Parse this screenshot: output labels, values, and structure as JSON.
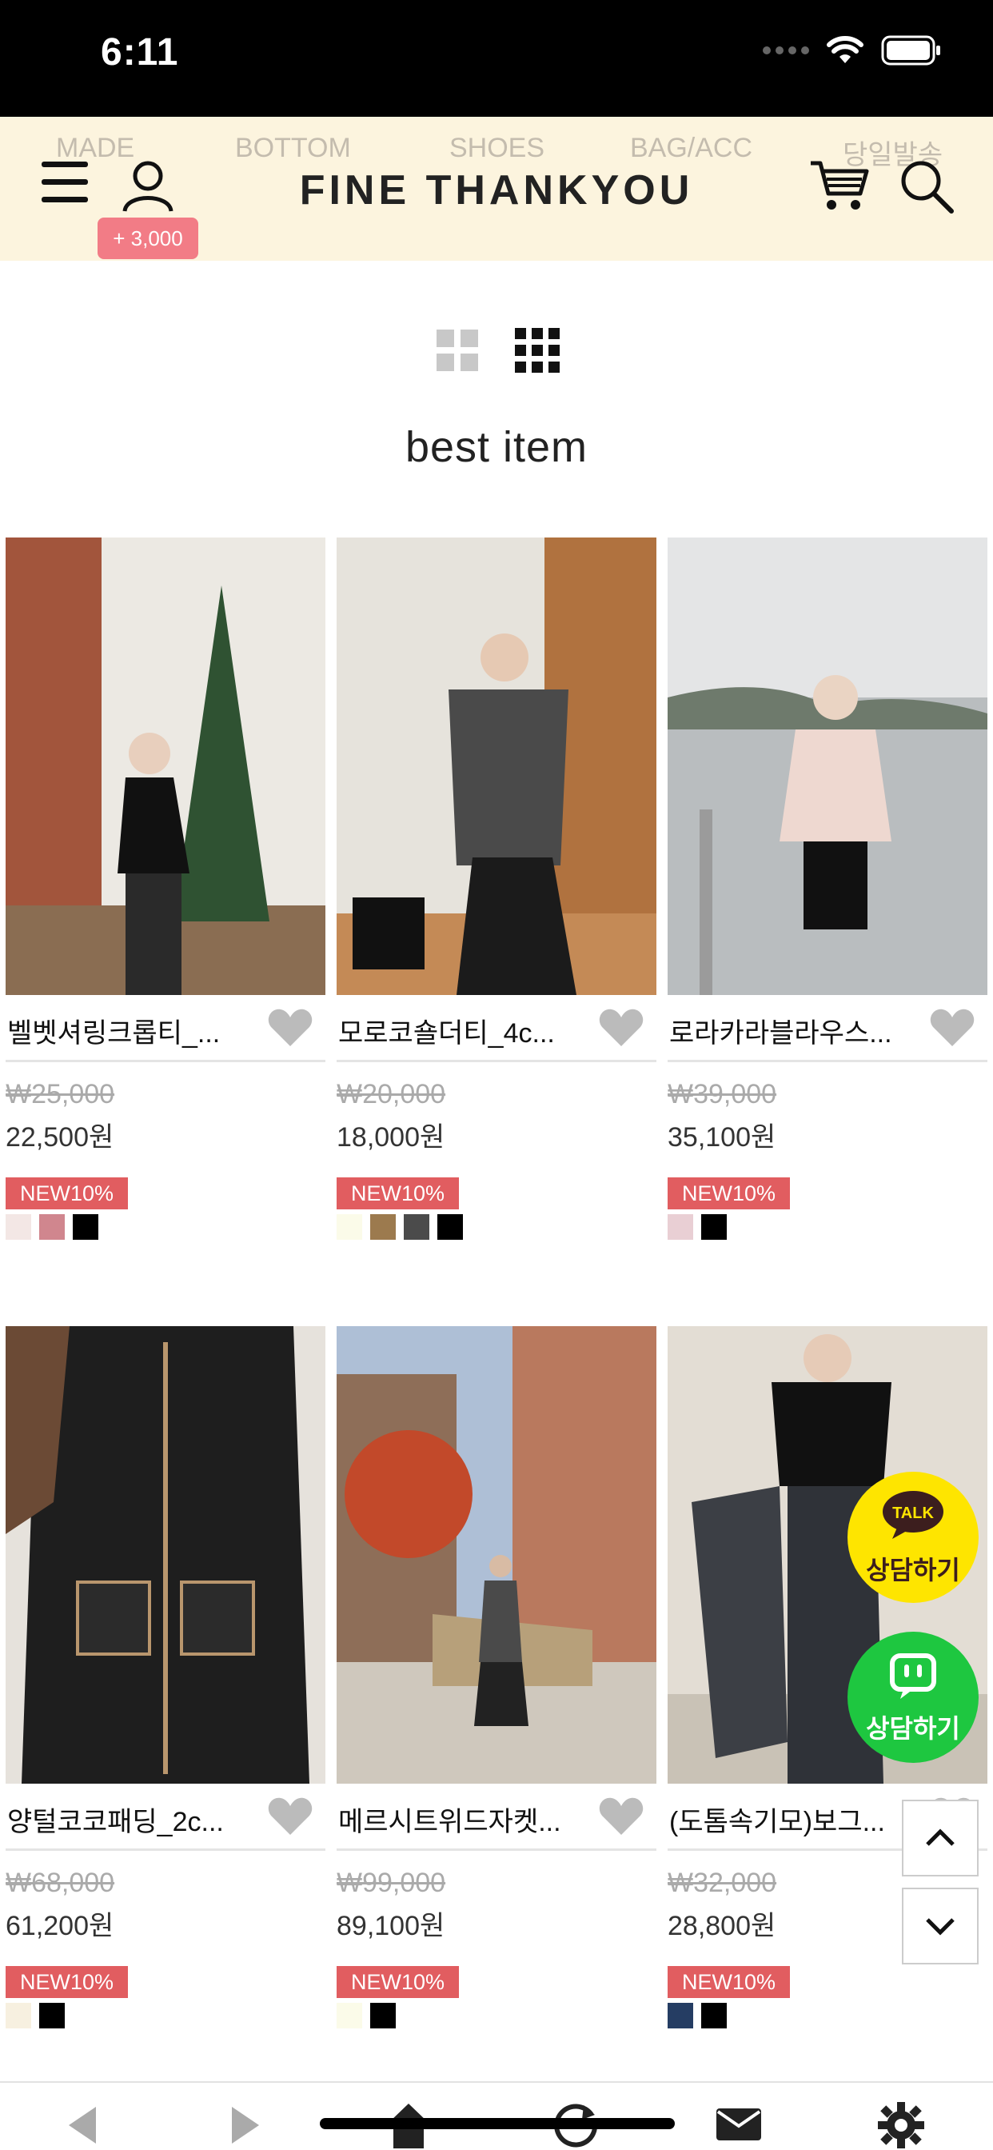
{
  "status": {
    "time": "6:11"
  },
  "header": {
    "categories": [
      "MADE",
      "BOTTOM",
      "SHOES",
      "BAG/ACC",
      "당일발송"
    ],
    "brand": "FINE THANKYOU",
    "point_badge": "+ 3,000",
    "icons": [
      "menu-icon",
      "user-icon",
      "cart-icon",
      "search-icon"
    ]
  },
  "view_toggle": {
    "options": [
      "grid-2",
      "grid-3"
    ],
    "selected": "grid-3"
  },
  "section": {
    "title": "best item"
  },
  "products": [
    {
      "name": "벨벳셔링크롭티_...",
      "original_price": "₩25,000",
      "sale_price": "22,500원",
      "badge": "NEW10%",
      "swatches": [
        "#f3e7e5",
        "#d0868e",
        "#000000"
      ]
    },
    {
      "name": "모로코숄더티_4c...",
      "original_price": "₩20,000",
      "sale_price": "18,000원",
      "badge": "NEW10%",
      "swatches": [
        "#fbfbe9",
        "#9c7a4e",
        "#4b4b4b",
        "#000000"
      ]
    },
    {
      "name": "로라카라블라우스...",
      "original_price": "₩39,000",
      "sale_price": "35,100원",
      "badge": "NEW10%",
      "swatches": [
        "#e9cfd4",
        "#000000"
      ]
    },
    {
      "name": "양털코코패딩_2c...",
      "original_price": "₩68,000",
      "sale_price": "61,200원",
      "badge": "NEW10%",
      "swatches": [
        "#f7f0e0",
        "#000000"
      ]
    },
    {
      "name": "메르시트위드자켓...",
      "original_price": "₩99,000",
      "sale_price": "89,100원",
      "badge": "NEW10%",
      "swatches": [
        "#fbfbe9",
        "#000000"
      ]
    },
    {
      "name": "(도톰속기모)보그...",
      "original_price": "₩32,000",
      "sale_price": "28,800원",
      "badge": "NEW10%",
      "swatches": [
        "#253d63",
        "#000000"
      ]
    }
  ],
  "floating": {
    "talk_label": "상담하기",
    "talk_icon_text": "TALK",
    "chat_label": "상담하기"
  },
  "colors": {
    "header_bg": "#fcf4de",
    "badge_pink": "#f27c86",
    "new_badge": "#e15d60",
    "kakao_yellow": "#fee500",
    "chat_green": "#1ec740"
  }
}
